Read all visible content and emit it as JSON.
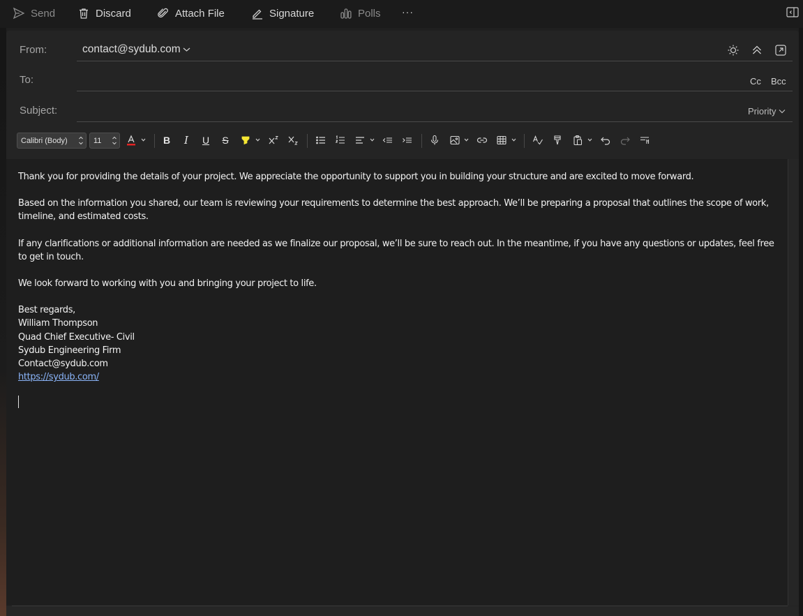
{
  "toolbar": {
    "send_label": "Send",
    "discard_label": "Discard",
    "attach_label": "Attach File",
    "signature_label": "Signature",
    "polls_label": "Polls",
    "more_label": "···"
  },
  "header": {
    "from_label": "From:",
    "from_value": "contact@sydub.com",
    "to_label": "To:",
    "to_value": "",
    "cc_label": "Cc",
    "bcc_label": "Bcc",
    "subject_label": "Subject:",
    "subject_value": "",
    "priority_label": "Priority"
  },
  "format": {
    "font_family": "Calibri (Body)",
    "font_size": "11",
    "font_color": "#e02424",
    "highlight_color": "#f5e633"
  },
  "body": {
    "paragraphs": [
      "Thank you for providing the details of your project. We appreciate the opportunity to support you in building your structure and are excited to move forward.",
      "Based on the information you shared, our team is reviewing your requirements to determine the best approach. We’ll be preparing a proposal that outlines the scope of work, timeline, and estimated costs.",
      "If any clarifications or additional information are needed as we finalize our proposal, we’ll be sure to reach out. In the meantime, if you have any questions or updates, feel free to get in touch.",
      "We look forward to working with you and bringing your project to life."
    ],
    "signature": {
      "closing": "Best regards,",
      "name": "William Thompson",
      "title": "Quad Chief Executive- Civil",
      "company": "Sydub Engineering Firm",
      "email": "Contact@sydub.com",
      "website": "https://sydub.com/"
    }
  },
  "colors": {
    "link": "#8ab4f8",
    "background": "#1f1f1f"
  }
}
